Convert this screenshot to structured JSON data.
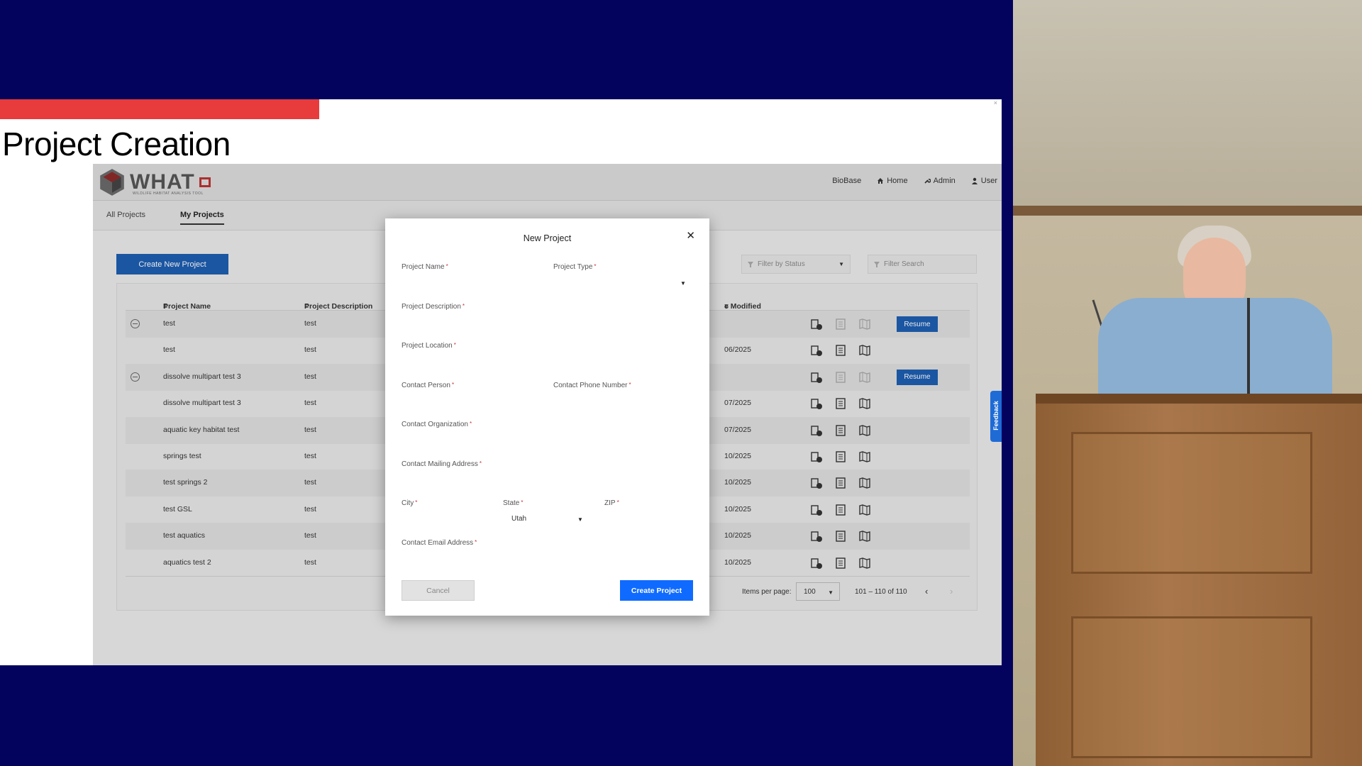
{
  "slide": {
    "title": "Project Creation",
    "close_mark": "×"
  },
  "app": {
    "brand": {
      "name": "WHAT",
      "tagline": "WILDLIFE HABITAT ANALYSIS TOOL"
    },
    "nav": {
      "biobase": "BioBase",
      "home": "Home",
      "admin": "Admin",
      "user": "User"
    },
    "tabs": [
      "All Projects",
      "My Projects"
    ],
    "active_tab": "My Projects",
    "create_button": "Create New Project",
    "filter_status_placeholder": "Filter by Status",
    "filter_search_placeholder": "Filter Search",
    "table": {
      "headers": {
        "name": "Project Name",
        "description": "Project Description",
        "modified": "e Modified"
      },
      "rows": [
        {
          "name": "test",
          "description": "test",
          "date": "",
          "collapsible": true,
          "resume": true
        },
        {
          "name": "test",
          "description": "test",
          "date": "06/2025",
          "collapsible": false,
          "resume": false
        },
        {
          "name": "dissolve multipart test 3",
          "description": "test",
          "date": "",
          "collapsible": true,
          "resume": true
        },
        {
          "name": "dissolve multipart test 3",
          "description": "test",
          "date": "07/2025",
          "collapsible": false,
          "resume": false
        },
        {
          "name": "aquatic key habitat test",
          "description": "test",
          "date": "07/2025",
          "collapsible": false,
          "resume": false
        },
        {
          "name": "springs test",
          "description": "test",
          "date": "10/2025",
          "collapsible": false,
          "resume": false
        },
        {
          "name": "test springs 2",
          "description": "test",
          "date": "10/2025",
          "collapsible": false,
          "resume": false
        },
        {
          "name": "test GSL",
          "description": "test",
          "date": "10/2025",
          "collapsible": false,
          "resume": false
        },
        {
          "name": "test aquatics",
          "description": "test",
          "date": "10/2025",
          "collapsible": false,
          "resume": false
        },
        {
          "name": "aquatics test 2",
          "description": "test",
          "date": "10/2025",
          "collapsible": false,
          "resume": false
        }
      ],
      "resume_label": "Resume"
    },
    "pagination": {
      "items_per_page_label": "Items per page:",
      "items_per_page": "100",
      "range": "101 – 110 of 110",
      "prev": "‹",
      "next": "›"
    },
    "feedback_label": "Feedback"
  },
  "modal": {
    "title": "New Project",
    "close": "✕",
    "required_mark": "*",
    "fields": {
      "project_name": "Project Name",
      "project_type": "Project Type",
      "project_description": "Project Description",
      "project_location": "Project Location",
      "contact_person": "Contact Person",
      "contact_phone": "Contact Phone Number",
      "contact_organization": "Contact Organization",
      "contact_mailing_address": "Contact Mailing Address",
      "city": "City",
      "state": "State",
      "state_value": "Utah",
      "zip": "ZIP",
      "contact_email": "Contact Email Address"
    },
    "cancel_button": "Cancel",
    "create_button": "Create Project"
  },
  "colors": {
    "background": "#03035e",
    "accent_red": "#e83b3b",
    "primary_blue": "#1e5eb0",
    "create_blue": "#0f6bff"
  }
}
